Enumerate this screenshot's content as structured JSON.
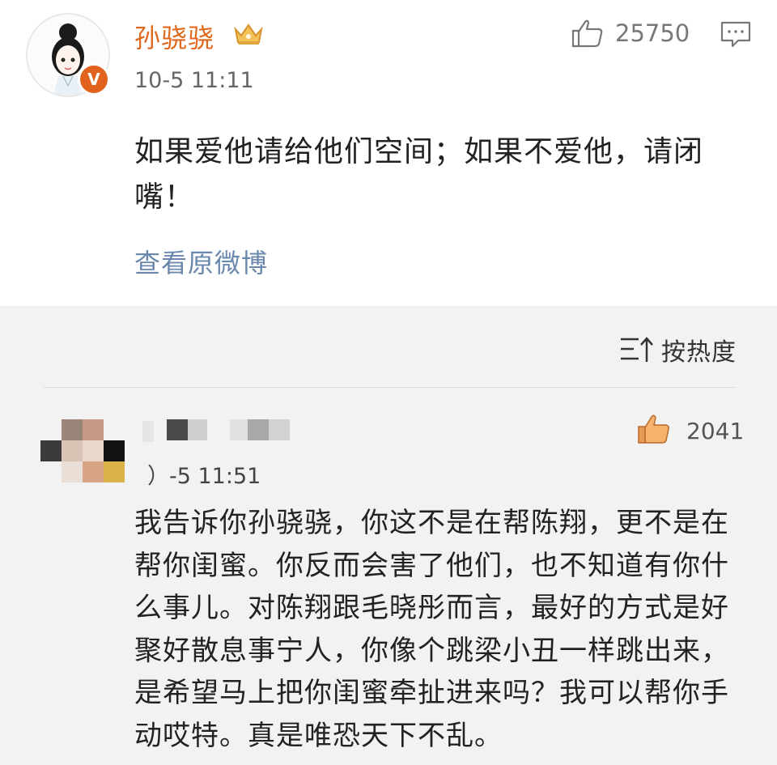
{
  "post": {
    "author": "孙骁骁",
    "time": "10-5 11:11",
    "likes": "25750",
    "text": "如果爱他请给他们空间；如果不爱他，请闭嘴！",
    "view_original": "查看原微博",
    "badge": "V"
  },
  "comments": {
    "sort_label": "按热度",
    "items": [
      {
        "time": "）-5 11:51",
        "likes": "2041",
        "text": "我告诉你孙骁骁，你这不是在帮陈翔，更不是在帮你闺蜜。你反而会害了他们，也不知道有你什么事儿。对陈翔跟毛晓彤而言，最好的方式是好聚好散息事宁人，你像个跳梁小丑一样跳出来，是希望马上把你闺蜜牵扯进来吗？我可以帮你手动哎特。真是唯恐天下不乱。"
      }
    ]
  },
  "colors": {
    "author_name": "#e0691d",
    "link": "#6a87ad",
    "v_badge": "#e0621c",
    "comment_bg": "#f2f2f2"
  },
  "icons": [
    "crown-icon",
    "thumbs-up-icon",
    "comment-icon",
    "sort-icon"
  ]
}
